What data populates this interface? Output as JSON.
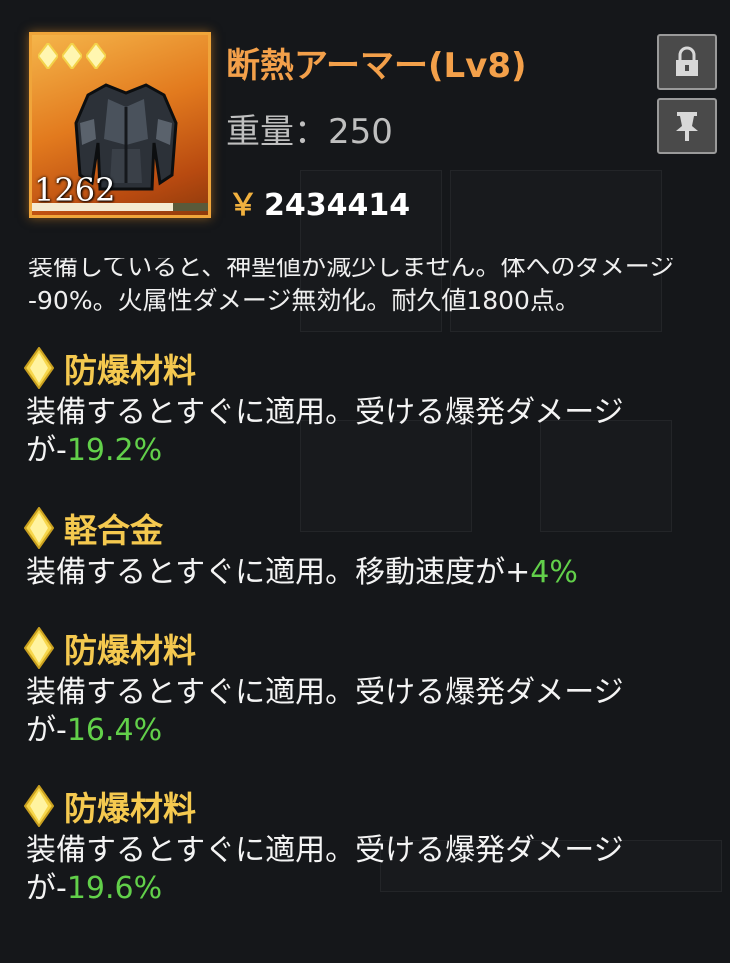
{
  "item": {
    "name": "断熱アーマー(Lv8)",
    "weight_label": "重量：",
    "weight_value": "250",
    "currency_symbol": "￥",
    "price": "2434414",
    "durability": "1262",
    "durability_fraction": 0.8,
    "rarity_count": 3,
    "description_line1": "装備していると、神聖値が減少しません。体へのダメージ",
    "description_line2": "-90%。火属性ダメージ無効化。耐久値1800点。"
  },
  "buttons": {
    "lock_icon": "lock-icon",
    "pin_icon": "pin-icon"
  },
  "modifiers": [
    {
      "name": "防爆材料",
      "text_before": "装備するとすぐに適用。受ける爆発ダメージ",
      "text_line2": "が-",
      "value": "19.2%"
    },
    {
      "name": "軽合金",
      "text_before": "装備するとすぐに適用。移動速度が+",
      "text_line2": "",
      "value": "4%"
    },
    {
      "name": "防爆材料",
      "text_before": "装備するとすぐに適用。受ける爆発ダメージ",
      "text_line2": "が-",
      "value": "16.4%"
    },
    {
      "name": "防爆材料",
      "text_before": "装備するとすぐに適用。受ける爆発ダメージ",
      "text_line2": "が-",
      "value": "19.6%"
    }
  ],
  "colors": {
    "name": "#f3a04a",
    "modifier_name": "#f5c94f",
    "value_green": "#62d04a",
    "frame_orange": "#f0a53a"
  }
}
